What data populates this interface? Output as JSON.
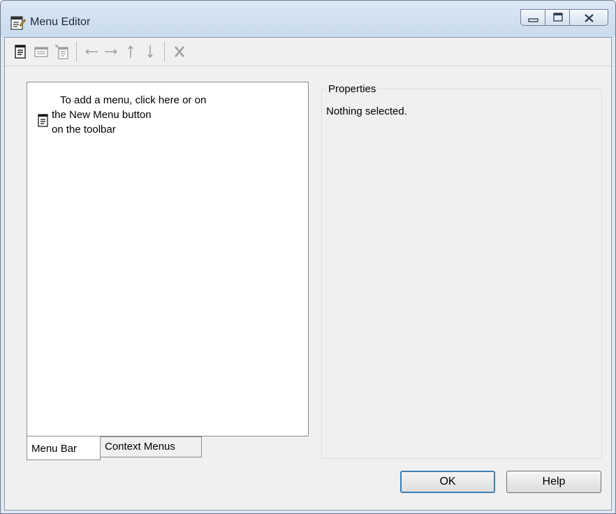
{
  "window": {
    "title": "Menu Editor",
    "icon": "menu-editor-app-icon",
    "controls": [
      "minimize-icon",
      "maximize-icon",
      "close-icon"
    ]
  },
  "toolbar": {
    "buttons": [
      {
        "name": "new-menu-icon",
        "enabled": true
      },
      {
        "name": "new-menu-item-icon",
        "enabled": false
      },
      {
        "name": "new-context-menu-icon",
        "enabled": false
      },
      {
        "name": "arrow-left-icon",
        "enabled": false
      },
      {
        "name": "arrow-right-icon",
        "enabled": false
      },
      {
        "name": "arrow-up-icon",
        "enabled": false
      },
      {
        "name": "arrow-down-icon",
        "enabled": false
      },
      {
        "name": "delete-icon",
        "enabled": false
      }
    ]
  },
  "tree": {
    "hint_lines": [
      "To add a menu, click here or on",
      "the New Menu button",
      "on the toolbar"
    ]
  },
  "tabs": [
    {
      "label": "Menu Bar",
      "active": true
    },
    {
      "label": "Context Menus",
      "active": false
    }
  ],
  "properties": {
    "legend": "Properties",
    "empty_text": "Nothing selected."
  },
  "buttons": {
    "ok": "OK",
    "help": "Help"
  },
  "colors": {
    "title_gradient_top": "#dbe7f4",
    "dialog_bg": "#f0f0f0",
    "disabled_icon": "#a0a0a0",
    "enabled_icon": "#1a1a1a"
  }
}
